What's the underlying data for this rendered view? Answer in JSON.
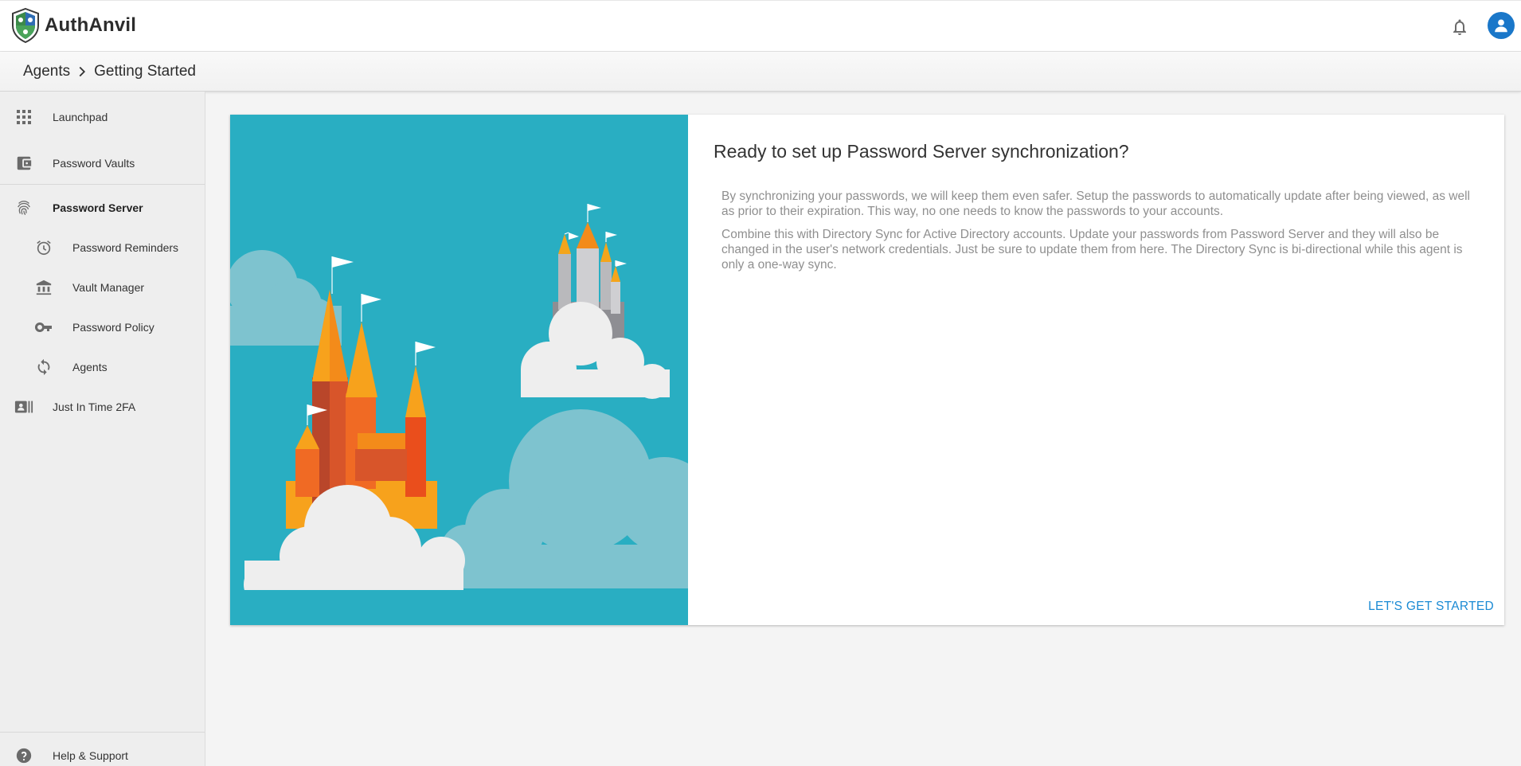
{
  "app": {
    "name": "AuthAnvil"
  },
  "breadcrumb": {
    "parent": "Agents",
    "current": "Getting Started"
  },
  "sidebar": {
    "items": [
      {
        "label": "Launchpad",
        "icon": "grid-icon"
      },
      {
        "label": "Password Vaults",
        "icon": "wallet-icon"
      },
      {
        "label": "Password Server",
        "icon": "fingerprint-icon",
        "active": true
      },
      {
        "label": "Password Reminders",
        "icon": "alarm-icon"
      },
      {
        "label": "Vault Manager",
        "icon": "bank-icon"
      },
      {
        "label": "Password Policy",
        "icon": "key-icon"
      },
      {
        "label": "Agents",
        "icon": "sync-icon"
      },
      {
        "label": "Just In Time 2FA",
        "icon": "id-card-icon"
      }
    ],
    "footer": {
      "label": "Help & Support",
      "icon": "help-icon"
    }
  },
  "main": {
    "title": "Ready to set up Password Server synchronization?",
    "paragraphs": [
      "By synchronizing your passwords, we will keep them even safer. Setup the passwords to automatically update after being viewed, as well as prior to their expiration. This way, no one needs to know the passwords to your accounts.",
      "Combine this with Directory Sync for Active Directory accounts. Update your passwords from Password Server and they will also be changed in the user's network credentials. Just be sure to update them from here. The Directory Sync is bi-directional while this agent is only a one-way sync."
    ],
    "cta_label": "LET'S GET STARTED"
  },
  "colors": {
    "accent": "#1a8ad4",
    "avatar": "#1a77c9",
    "illustration_bg": "#29aec2"
  }
}
